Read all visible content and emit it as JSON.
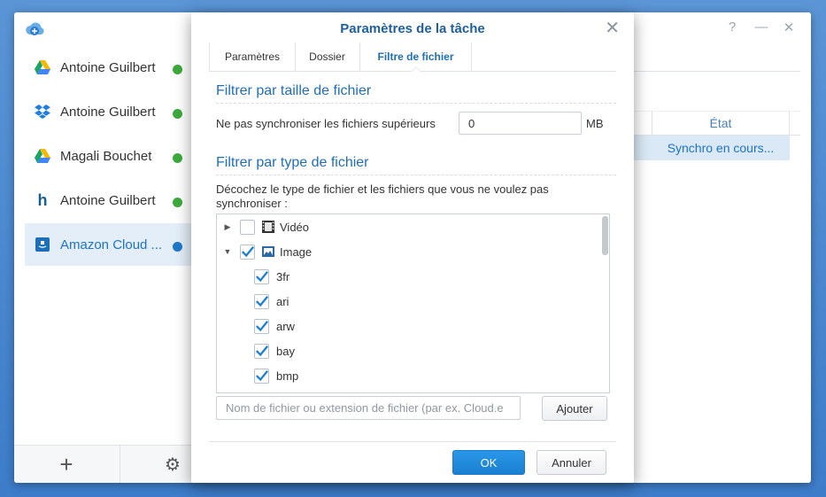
{
  "app": {
    "accounts": [
      {
        "label": "Antoine Guilbert",
        "icon": "google-drive-icon"
      },
      {
        "label": "Antoine Guilbert",
        "icon": "dropbox-icon"
      },
      {
        "label": "Magali Bouchet",
        "icon": "google-drive-icon"
      },
      {
        "label": "Antoine Guilbert",
        "icon": "hubic-icon"
      },
      {
        "label": "Amazon Cloud ...",
        "icon": "amazon-cloud-icon",
        "selected": true
      }
    ],
    "grid": {
      "column_state": "État",
      "row_state": "Synchro en cours..."
    },
    "colors": {
      "accent": "#1f6fb8",
      "selection": "#e4eef8",
      "status_ok": "#3daa3d"
    }
  },
  "dialog": {
    "title": "Paramètres de la tâche",
    "tabs": [
      {
        "label": "Paramètres"
      },
      {
        "label": "Dossier"
      },
      {
        "label": "Filtre de fichier",
        "active": true
      }
    ],
    "size_filter": {
      "heading": "Filtrer par taille de fichier",
      "label": "Ne pas synchroniser les fichiers supérieurs",
      "value": "0",
      "unit": "MB"
    },
    "type_filter": {
      "heading": "Filtrer par type de fichier",
      "description": "Décochez le type de fichier et les fichiers que vous ne voulez pas synchroniser :",
      "tree": [
        {
          "label": "Vidéo",
          "checked": false,
          "expanded": false,
          "icon": "video-film-icon"
        },
        {
          "label": "Image",
          "checked": true,
          "expanded": true,
          "icon": "image-icon"
        },
        {
          "label": "3fr",
          "checked": true
        },
        {
          "label": "ari",
          "checked": true
        },
        {
          "label": "arw",
          "checked": true
        },
        {
          "label": "bay",
          "checked": true
        },
        {
          "label": "bmp",
          "checked": true
        }
      ],
      "filename_placeholder": "Nom de fichier ou extension de fichier (par ex. Cloud.e",
      "add_label": "Ajouter"
    },
    "ok_label": "OK",
    "cancel_label": "Annuler"
  }
}
